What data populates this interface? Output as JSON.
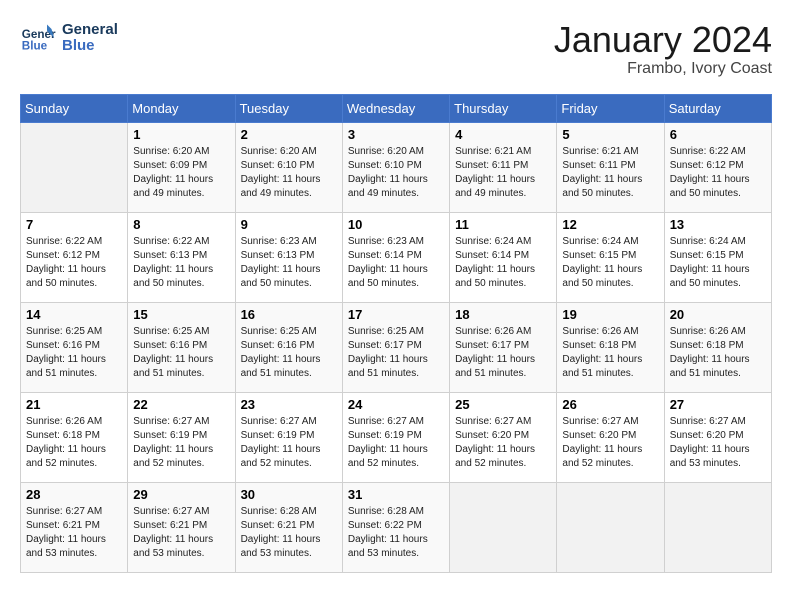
{
  "header": {
    "logo_line1": "General",
    "logo_line2": "Blue",
    "title": "January 2024",
    "subtitle": "Frambo, Ivory Coast"
  },
  "days_of_week": [
    "Sunday",
    "Monday",
    "Tuesday",
    "Wednesday",
    "Thursday",
    "Friday",
    "Saturday"
  ],
  "weeks": [
    [
      {
        "day": "",
        "info": ""
      },
      {
        "day": "1",
        "info": "Sunrise: 6:20 AM\nSunset: 6:09 PM\nDaylight: 11 hours\nand 49 minutes."
      },
      {
        "day": "2",
        "info": "Sunrise: 6:20 AM\nSunset: 6:10 PM\nDaylight: 11 hours\nand 49 minutes."
      },
      {
        "day": "3",
        "info": "Sunrise: 6:20 AM\nSunset: 6:10 PM\nDaylight: 11 hours\nand 49 minutes."
      },
      {
        "day": "4",
        "info": "Sunrise: 6:21 AM\nSunset: 6:11 PM\nDaylight: 11 hours\nand 49 minutes."
      },
      {
        "day": "5",
        "info": "Sunrise: 6:21 AM\nSunset: 6:11 PM\nDaylight: 11 hours\nand 50 minutes."
      },
      {
        "day": "6",
        "info": "Sunrise: 6:22 AM\nSunset: 6:12 PM\nDaylight: 11 hours\nand 50 minutes."
      }
    ],
    [
      {
        "day": "7",
        "info": "Sunrise: 6:22 AM\nSunset: 6:12 PM\nDaylight: 11 hours\nand 50 minutes."
      },
      {
        "day": "8",
        "info": "Sunrise: 6:22 AM\nSunset: 6:13 PM\nDaylight: 11 hours\nand 50 minutes."
      },
      {
        "day": "9",
        "info": "Sunrise: 6:23 AM\nSunset: 6:13 PM\nDaylight: 11 hours\nand 50 minutes."
      },
      {
        "day": "10",
        "info": "Sunrise: 6:23 AM\nSunset: 6:14 PM\nDaylight: 11 hours\nand 50 minutes."
      },
      {
        "day": "11",
        "info": "Sunrise: 6:24 AM\nSunset: 6:14 PM\nDaylight: 11 hours\nand 50 minutes."
      },
      {
        "day": "12",
        "info": "Sunrise: 6:24 AM\nSunset: 6:15 PM\nDaylight: 11 hours\nand 50 minutes."
      },
      {
        "day": "13",
        "info": "Sunrise: 6:24 AM\nSunset: 6:15 PM\nDaylight: 11 hours\nand 50 minutes."
      }
    ],
    [
      {
        "day": "14",
        "info": "Sunrise: 6:25 AM\nSunset: 6:16 PM\nDaylight: 11 hours\nand 51 minutes."
      },
      {
        "day": "15",
        "info": "Sunrise: 6:25 AM\nSunset: 6:16 PM\nDaylight: 11 hours\nand 51 minutes."
      },
      {
        "day": "16",
        "info": "Sunrise: 6:25 AM\nSunset: 6:16 PM\nDaylight: 11 hours\nand 51 minutes."
      },
      {
        "day": "17",
        "info": "Sunrise: 6:25 AM\nSunset: 6:17 PM\nDaylight: 11 hours\nand 51 minutes."
      },
      {
        "day": "18",
        "info": "Sunrise: 6:26 AM\nSunset: 6:17 PM\nDaylight: 11 hours\nand 51 minutes."
      },
      {
        "day": "19",
        "info": "Sunrise: 6:26 AM\nSunset: 6:18 PM\nDaylight: 11 hours\nand 51 minutes."
      },
      {
        "day": "20",
        "info": "Sunrise: 6:26 AM\nSunset: 6:18 PM\nDaylight: 11 hours\nand 51 minutes."
      }
    ],
    [
      {
        "day": "21",
        "info": "Sunrise: 6:26 AM\nSunset: 6:18 PM\nDaylight: 11 hours\nand 52 minutes."
      },
      {
        "day": "22",
        "info": "Sunrise: 6:27 AM\nSunset: 6:19 PM\nDaylight: 11 hours\nand 52 minutes."
      },
      {
        "day": "23",
        "info": "Sunrise: 6:27 AM\nSunset: 6:19 PM\nDaylight: 11 hours\nand 52 minutes."
      },
      {
        "day": "24",
        "info": "Sunrise: 6:27 AM\nSunset: 6:19 PM\nDaylight: 11 hours\nand 52 minutes."
      },
      {
        "day": "25",
        "info": "Sunrise: 6:27 AM\nSunset: 6:20 PM\nDaylight: 11 hours\nand 52 minutes."
      },
      {
        "day": "26",
        "info": "Sunrise: 6:27 AM\nSunset: 6:20 PM\nDaylight: 11 hours\nand 52 minutes."
      },
      {
        "day": "27",
        "info": "Sunrise: 6:27 AM\nSunset: 6:20 PM\nDaylight: 11 hours\nand 53 minutes."
      }
    ],
    [
      {
        "day": "28",
        "info": "Sunrise: 6:27 AM\nSunset: 6:21 PM\nDaylight: 11 hours\nand 53 minutes."
      },
      {
        "day": "29",
        "info": "Sunrise: 6:27 AM\nSunset: 6:21 PM\nDaylight: 11 hours\nand 53 minutes."
      },
      {
        "day": "30",
        "info": "Sunrise: 6:28 AM\nSunset: 6:21 PM\nDaylight: 11 hours\nand 53 minutes."
      },
      {
        "day": "31",
        "info": "Sunrise: 6:28 AM\nSunset: 6:22 PM\nDaylight: 11 hours\nand 53 minutes."
      },
      {
        "day": "",
        "info": ""
      },
      {
        "day": "",
        "info": ""
      },
      {
        "day": "",
        "info": ""
      }
    ]
  ]
}
